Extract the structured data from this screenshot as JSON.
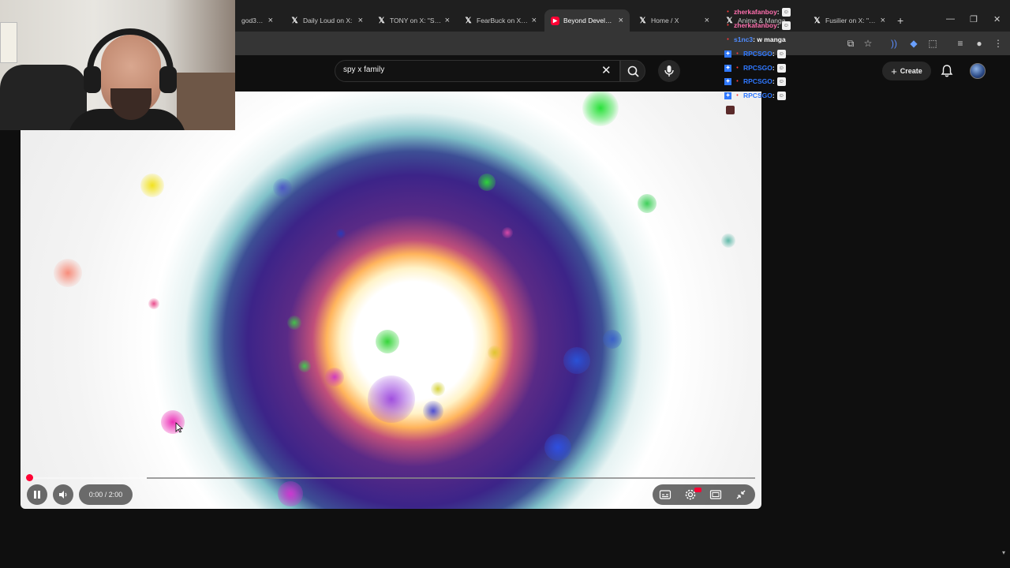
{
  "browser": {
    "tabs": [
      {
        "label": "god36 | St",
        "icon": "none",
        "active": false
      },
      {
        "label": "Daily Loud on X: ",
        "icon": "x-logo",
        "active": false
      },
      {
        "label": "TONY on X: \"Stran",
        "icon": "x-logo",
        "active": false
      },
      {
        "label": "FearBuck on X: \"M",
        "icon": "x-logo",
        "active": false
      },
      {
        "label": "Beyond Develope",
        "icon": "youtube-logo",
        "active": true
      },
      {
        "label": "Home / X",
        "icon": "x-logo",
        "active": false
      },
      {
        "label": "Anime & Manga",
        "icon": "x-logo",
        "active": false
      },
      {
        "label": "Fusilier on X: \"The",
        "icon": "x-logo",
        "active": false
      }
    ],
    "new_tab_label": "+"
  },
  "youtube": {
    "search": {
      "value": "spy x family",
      "placeholder": "Search"
    },
    "create_label": "Create"
  },
  "player": {
    "time_display": "0:00 / 2:00",
    "progress_fraction": 0.0
  },
  "chat": {
    "messages": [
      {
        "user": "zherkafanboy",
        "text": "",
        "user_color": "#ff6fae"
      },
      {
        "user": "zherkafanboy",
        "text": "",
        "user_color": "#ff6fae"
      },
      {
        "user": "s1nc3",
        "text": "w manga",
        "user_color": "#4f8cff"
      },
      {
        "user": "RPCSGO",
        "text": "",
        "user_color": "#2f78ff"
      },
      {
        "user": "RPCSGO",
        "text": "",
        "user_color": "#2f78ff"
      },
      {
        "user": "RPCSGO",
        "text": "",
        "user_color": "#2f78ff"
      },
      {
        "user": "RPCSGO",
        "text": "",
        "user_color": "#2f78ff"
      }
    ]
  },
  "colors": {
    "accent_red": "#ff0033",
    "page_bg": "#0f0f0f",
    "tabstrip_bg": "#1f1f1f",
    "toolbar_bg": "#353535"
  }
}
